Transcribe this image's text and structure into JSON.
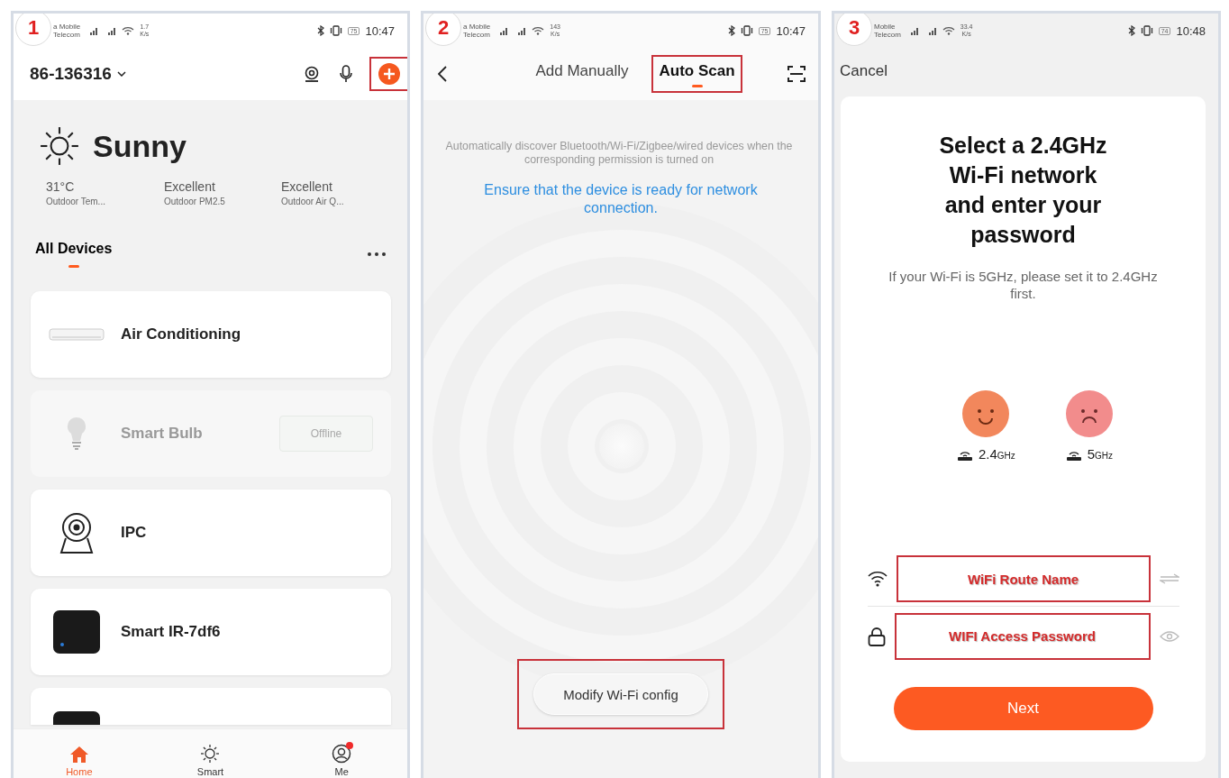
{
  "home_screen": {
    "step": "1",
    "status_bar": {
      "carrier_1": "a Mobile",
      "carrier_2": "Telecom",
      "net_speed": "1.7",
      "speed_unit": "K/s",
      "battery": "75",
      "time": "10:47"
    },
    "home_name": "86-136316",
    "add_button": {
      "highlighted": true
    },
    "weather": {
      "condition": "Sunny",
      "stats": [
        {
          "value": "31°C",
          "label": "Outdoor Tem..."
        },
        {
          "value": "Excellent",
          "label": "Outdoor PM2.5"
        },
        {
          "value": "Excellent",
          "label": "Outdoor Air Q..."
        }
      ]
    },
    "section_tabs": [
      {
        "label": "All Devices",
        "selected": true
      }
    ],
    "devices": [
      {
        "kind": "ac",
        "name": "Air Conditioning",
        "offline": false
      },
      {
        "kind": "bulb",
        "name": "Smart Bulb",
        "offline": true,
        "badge": "Offline"
      },
      {
        "kind": "camera",
        "name": "IPC",
        "offline": false
      },
      {
        "kind": "ir",
        "name": "Smart IR-7df6",
        "offline": false
      },
      {
        "kind": "ir",
        "offline": false
      }
    ],
    "nav": [
      {
        "label": "Home",
        "selected": true,
        "notification": false
      },
      {
        "label": "Smart",
        "selected": false,
        "notification": false
      },
      {
        "label": "Me",
        "selected": false,
        "notification": true
      }
    ]
  },
  "add_device_screen": {
    "step": "2",
    "status_bar": {
      "carrier_1": "a Mobile",
      "carrier_2": "Telecom",
      "net_speed": "143",
      "speed_unit": "K/s",
      "battery": "75",
      "time": "10:47"
    },
    "tabs": [
      {
        "label": "Add Manually",
        "selected": false,
        "highlighted": false
      },
      {
        "label": "Auto Scan",
        "selected": true,
        "highlighted": true
      }
    ],
    "hint": "Automatically discover Bluetooth/Wi-Fi/Zigbee/wired devices when the corresponding permission is turned on",
    "notice": "Ensure that the device is ready for network connection.",
    "config_button": {
      "label": "Modify Wi-Fi config",
      "highlighted": true
    }
  },
  "wifi_screen": {
    "step": "3",
    "status_bar": {
      "carrier_1": "Mobile",
      "carrier_2": "Telecom",
      "net_speed": "33.4",
      "speed_unit": "K/s",
      "battery": "74",
      "time": "10:48"
    },
    "cancel": "Cancel",
    "title": "Select a 2.4GHz Wi-Fi network and enter your password",
    "note": "If your Wi-Fi is 5GHz, please set it to 2.4GHz first.",
    "bands": [
      {
        "value": "2.4",
        "unit": "GHz"
      },
      {
        "value": "5",
        "unit": "GHz"
      }
    ],
    "fields": [
      {
        "kind": "network",
        "placeholder": "WiFi Route Name",
        "highlighted": true
      },
      {
        "kind": "password",
        "placeholder": "WIFI Access Password",
        "highlighted": true
      }
    ],
    "next_button": "Next"
  }
}
